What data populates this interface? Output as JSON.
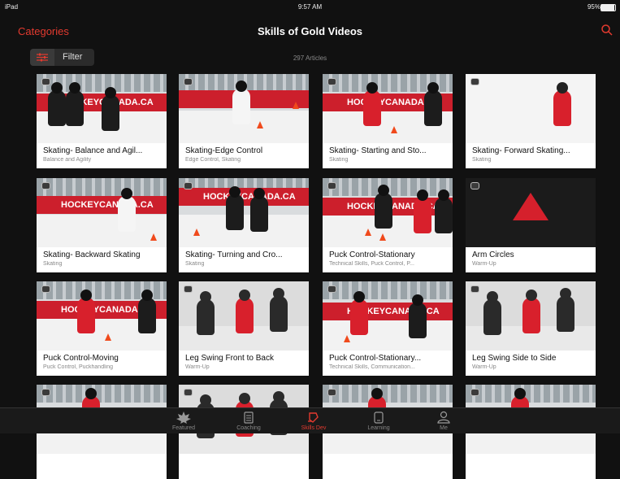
{
  "status_bar": {
    "device": "iPad",
    "time": "9:57 AM",
    "battery": "95%"
  },
  "nav": {
    "categories_label": "Categories",
    "title": "Skills of Gold Videos"
  },
  "filter": {
    "label": "Filter",
    "article_count": "297 Articles"
  },
  "colors": {
    "accent": "#e33a2f",
    "background": "#111111"
  },
  "cards": [
    {
      "title": "Skating- Balance and Agil...",
      "subtitle": "Balance and Agility",
      "scene": "players-red-boards"
    },
    {
      "title": "Skating-Edge Control",
      "subtitle": "Edge Control, Skating",
      "scene": "white-player-ice"
    },
    {
      "title": "Skating- Starting and Sto...",
      "subtitle": "Skating",
      "scene": "red-player-boards"
    },
    {
      "title": "Skating- Forward Skating...",
      "subtitle": "Skating",
      "scene": "white-ice-small-player"
    },
    {
      "title": "Skating- Backward Skating",
      "subtitle": "Skating",
      "scene": "white-player-red-boards"
    },
    {
      "title": "Skating- Turning and Cro...",
      "subtitle": "Skating",
      "scene": "two-players-red-boards"
    },
    {
      "title": "Puck Control-Stationary",
      "subtitle": "Technical Skills, Puck Control, P...",
      "scene": "black-player-boards"
    },
    {
      "title": "Arm Circles",
      "subtitle": "Warm-Up",
      "scene": "black-jersey-logo"
    },
    {
      "title": "Puck Control-Moving",
      "subtitle": "Puck Control, Puckhandling",
      "scene": "red-player-boards"
    },
    {
      "title": "Leg Swing Front to Back",
      "subtitle": "Warm-Up",
      "scene": "warmup-row"
    },
    {
      "title": "Puck Control-Stationary...",
      "subtitle": "Technical Skills, Communication...",
      "scene": "red-black-players"
    },
    {
      "title": "Leg Swing Side to Side",
      "subtitle": "Warm-Up",
      "scene": "warmup-row"
    },
    {
      "title": "",
      "subtitle": "",
      "scene": "arena-partial"
    },
    {
      "title": "",
      "subtitle": "",
      "scene": "warmup-partial"
    },
    {
      "title": "",
      "subtitle": "",
      "scene": "arena-partial"
    },
    {
      "title": "",
      "subtitle": "",
      "scene": "arena-partial"
    }
  ],
  "board_text": "HOCKEYCANADA.CA",
  "tabs": [
    {
      "label": "Featured",
      "icon": "maple-leaf-icon",
      "active": false
    },
    {
      "label": "Coaching",
      "icon": "clipboard-icon",
      "active": false
    },
    {
      "label": "Skills Dev",
      "icon": "skills-dev-icon",
      "active": true
    },
    {
      "label": "Learning",
      "icon": "tablet-icon",
      "active": false
    },
    {
      "label": "Me",
      "icon": "person-icon",
      "active": false
    }
  ]
}
